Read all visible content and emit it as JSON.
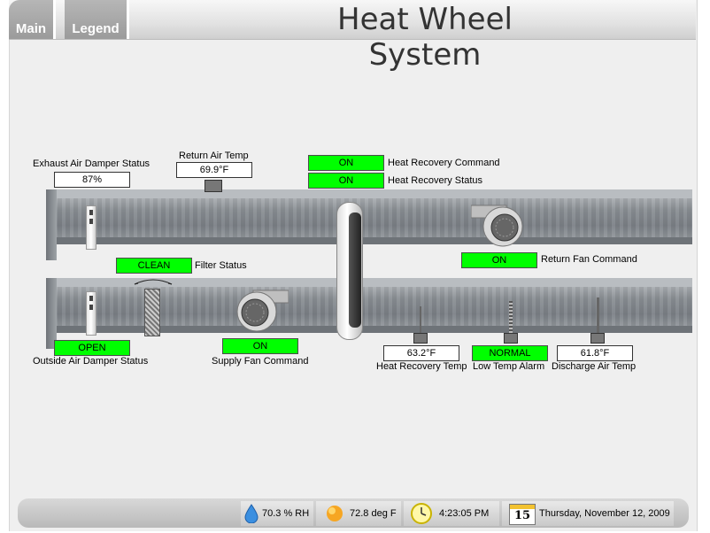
{
  "header": {
    "title": "Heat Wheel System",
    "tabs": [
      {
        "label": "Main"
      },
      {
        "label": "Legend"
      }
    ]
  },
  "exhaust_damper": {
    "label": "Exhaust Air Damper Status",
    "value": "87%"
  },
  "return_air_temp": {
    "label": "Return Air Temp",
    "value": "69.9°F"
  },
  "heat_recovery_command": {
    "label": "Heat Recovery Command",
    "value": "ON"
  },
  "heat_recovery_status": {
    "label": "Heat Recovery Status",
    "value": "ON"
  },
  "return_fan_command": {
    "label": "Return Fan Command",
    "value": "ON"
  },
  "filter_status": {
    "label": "Filter Status",
    "value": "CLEAN"
  },
  "outside_damper": {
    "label": "Outside Air Damper Status",
    "value": "OPEN"
  },
  "supply_fan_command": {
    "label": "Supply Fan Command",
    "value": "ON"
  },
  "heat_recovery_temp": {
    "label": "Heat Recovery Temp",
    "value": "63.2°F"
  },
  "low_temp_alarm": {
    "label": "Low Temp Alarm",
    "value": "NORMAL"
  },
  "discharge_air_temp": {
    "label": "Discharge Air Temp",
    "value": "61.8°F"
  },
  "footer": {
    "humidity": "70.3 % RH",
    "temperature": "72.8 deg F",
    "time": "4:23:05 PM",
    "calendar_day": "15",
    "date": "Thursday, November 12, 2009"
  },
  "colors": {
    "status_green": "#00ff00",
    "duct_gray": "#8a8f94"
  },
  "icons": [
    "water-drop-icon",
    "sun-icon",
    "clock-icon",
    "calendar-icon",
    "fan-icon",
    "damper-icon",
    "sensor-icon"
  ]
}
